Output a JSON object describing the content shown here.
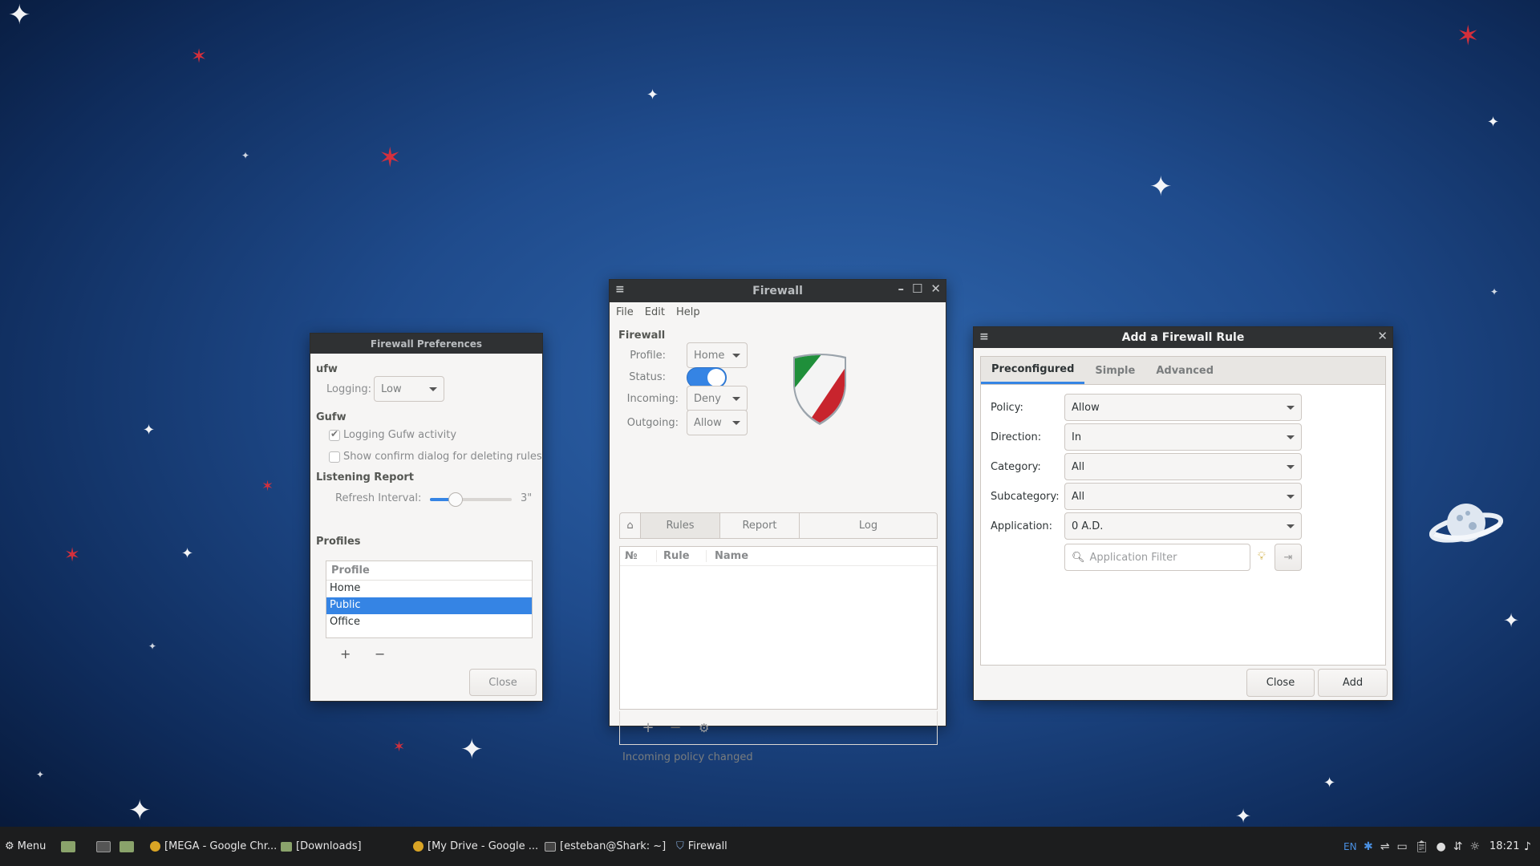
{
  "prefs": {
    "title": "Firewall Preferences",
    "ufw_label": "ufw",
    "logging_label": "Logging:",
    "logging_value": "Low",
    "gufw_label": "Gufw",
    "logging_activity": "Logging Gufw activity",
    "confirm_delete": "Show confirm dialog for deleting rules",
    "listening_label": "Listening Report",
    "refresh_label": "Refresh Interval:",
    "refresh_value": "3\"",
    "profiles_label": "Profiles",
    "profile_header": "Profile",
    "profiles": [
      "Home",
      "Public",
      "Office"
    ],
    "selected_profile": "Public",
    "add": "+",
    "remove": "−",
    "close": "Close"
  },
  "main": {
    "title": "Firewall",
    "menu": [
      "File",
      "Edit",
      "Help"
    ],
    "section": "Firewall",
    "profile_label": "Profile:",
    "profile_value": "Home",
    "status_label": "Status:",
    "status_on": true,
    "incoming_label": "Incoming:",
    "incoming_value": "Deny",
    "outgoing_label": "Outgoing:",
    "outgoing_value": "Allow",
    "tabs": [
      "Rules",
      "Report",
      "Log"
    ],
    "col_no": "№",
    "col_rule": "Rule",
    "col_name": "Name",
    "add": "+",
    "remove": "−",
    "status_message": "Incoming policy changed"
  },
  "addrule": {
    "title": "Add a Firewall Rule",
    "tabs": [
      "Preconfigured",
      "Simple",
      "Advanced"
    ],
    "policy_label": "Policy:",
    "policy_value": "Allow",
    "direction_label": "Direction:",
    "direction_value": "In",
    "category_label": "Category:",
    "category_value": "All",
    "subcategory_label": "Subcategory:",
    "subcategory_value": "All",
    "application_label": "Application:",
    "application_value": "0 A.D.",
    "filter_placeholder": "Application Filter",
    "close": "Close",
    "add": "Add"
  },
  "taskbar": {
    "menu_label": "Menu",
    "items": [
      "[MEGA - Google Chr...",
      "[Downloads]",
      "[My Drive - Google ...",
      "[esteban@Shark: ~]",
      "Firewall"
    ],
    "lang": "EN",
    "clock": "18:21"
  },
  "colors": {
    "accent": "#3584e4",
    "titlebar": "#2f3133",
    "taskbar": "#1c1d1e"
  }
}
